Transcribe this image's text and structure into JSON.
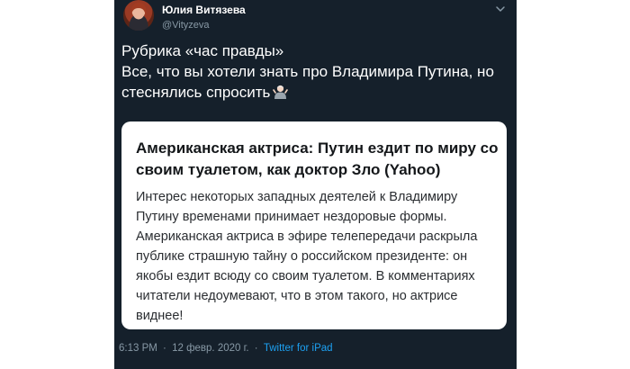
{
  "author": {
    "name": "Юлия Витязева",
    "handle": "@Vityzeva"
  },
  "icons": {
    "avatar": "avatar-photo",
    "menu": "chevron-down-icon",
    "emoji": "person-shrugging-emoji"
  },
  "tweet": {
    "lines": [
      "Рубрика «час правды»",
      "Все, что вы хотели знать про Владимира Путина, но",
      "стеснялись спросить"
    ]
  },
  "card": {
    "title_lines": [
      "Американская актриса: Путин ездит по миру со",
      "своим туалетом, как доктор Зло (Yahoo)"
    ],
    "body_lines": [
      "Интерес некоторых западных деятелей к Владимиру",
      "Путину временами принимает нездоровые формы.",
      "Американская актриса в эфире телепередачи раскрыла",
      "публике страшную тайну о российском президенте: он",
      "якобы ездит всюду со своим туалетом. В комментариях",
      "читатели недоумевают, что в этом такого, но актрисе",
      "виднее!"
    ]
  },
  "footer": {
    "time": "6:13 PM",
    "separator": "·",
    "date": "12 февр. 2020 г.",
    "source": "Twitter for iPad"
  },
  "colors": {
    "background": "#15202b",
    "handle": "#8899a6",
    "link": "#1da1f2",
    "card": "#ffffff"
  }
}
